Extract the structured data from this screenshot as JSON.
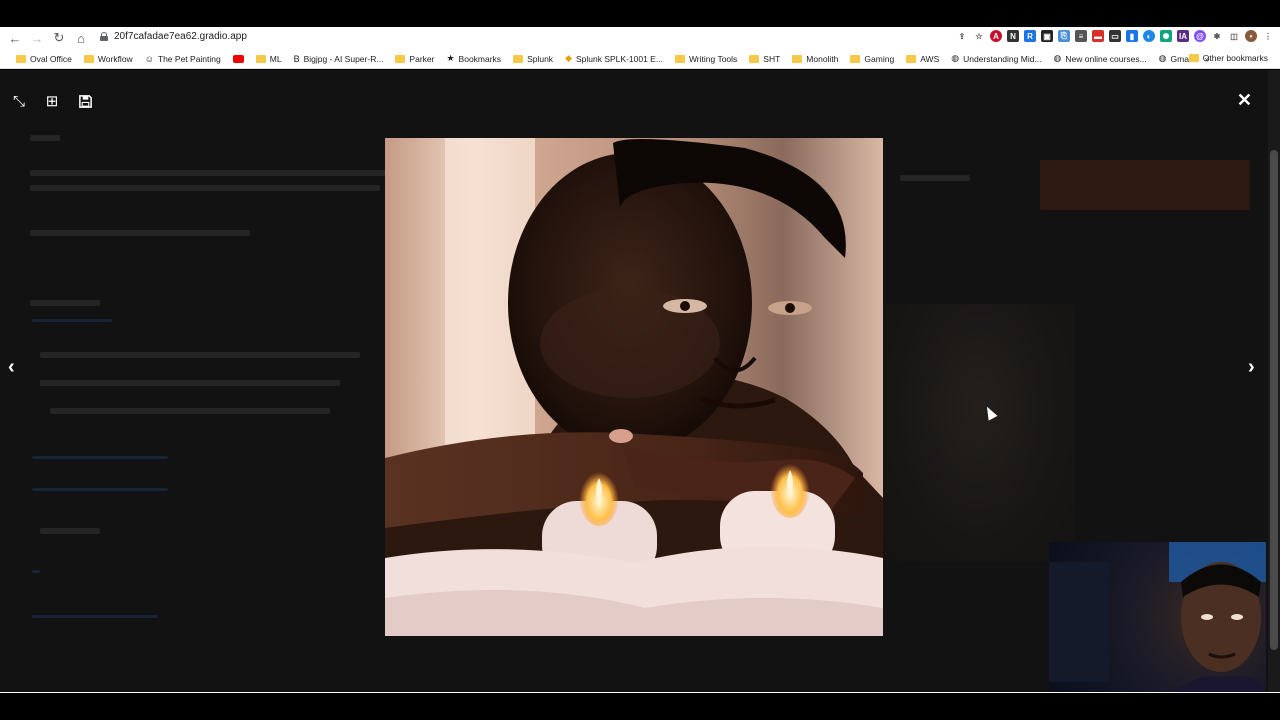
{
  "browser": {
    "url": "20f7cafadae7ea62.gradio.app",
    "bookmarks": [
      {
        "label": "Oval Office",
        "icon": "folder"
      },
      {
        "label": "Workflow",
        "icon": "folder"
      },
      {
        "label": "The Pet Painting",
        "icon": "site"
      },
      {
        "label": "",
        "icon": "youtube"
      },
      {
        "label": "ML",
        "icon": "folder"
      },
      {
        "label": "Bigjpg - AI Super-R...",
        "icon": "site"
      },
      {
        "label": "Parker",
        "icon": "folder"
      },
      {
        "label": "Bookmarks",
        "icon": "star"
      },
      {
        "label": "Splunk",
        "icon": "folder"
      },
      {
        "label": "Splunk SPLK-1001 E...",
        "icon": "site"
      },
      {
        "label": "Writing Tools",
        "icon": "folder"
      },
      {
        "label": "SHT",
        "icon": "folder"
      },
      {
        "label": "Monolith",
        "icon": "folder"
      },
      {
        "label": "Gaming",
        "icon": "folder"
      },
      {
        "label": "AWS",
        "icon": "folder"
      },
      {
        "label": "Understanding Mid...",
        "icon": "globe"
      },
      {
        "label": "New online courses...",
        "icon": "globe"
      },
      {
        "label": "Gmail",
        "icon": "globe"
      }
    ],
    "overflow": "»",
    "other_bookmarks": "Other bookmarks"
  },
  "viewer": {
    "icons": {
      "minimize": "⤡",
      "grid": "⊞",
      "save": "💾",
      "close": "✕",
      "prev": "‹",
      "next": "›"
    }
  },
  "colors": {
    "accent": "#3b82f6",
    "overlay": "#121212",
    "folder": "#f7c948"
  }
}
